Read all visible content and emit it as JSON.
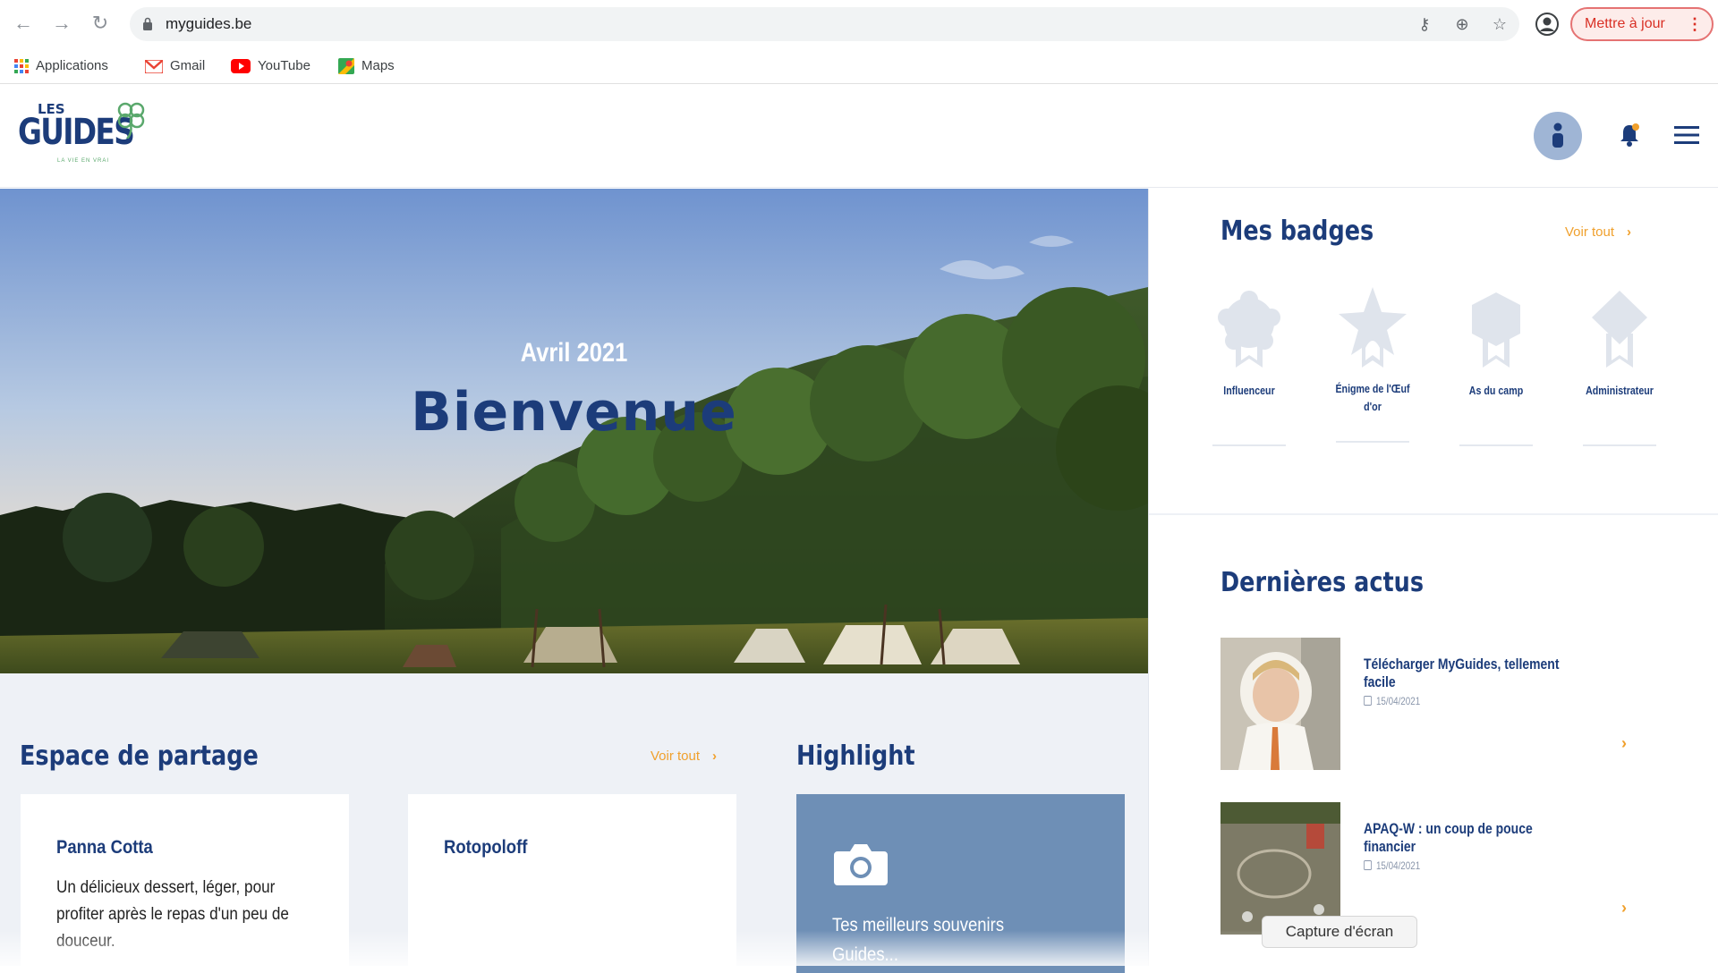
{
  "browser": {
    "url": "myguides.be",
    "update_label": "Mettre à jour",
    "update_dots": "⋮",
    "bookmarks": [
      {
        "label": "Applications",
        "icon": "apps-grid-icon"
      },
      {
        "label": "Gmail",
        "icon": "gmail-icon"
      },
      {
        "label": "YouTube",
        "icon": "youtube-icon"
      },
      {
        "label": "Maps",
        "icon": "maps-icon"
      }
    ]
  },
  "logo": {
    "les": "LES",
    "guides": "GUIDES",
    "tagline": "LA VIE EN VRAI"
  },
  "hero": {
    "date": "Avril 2021",
    "title": "Bienvenue"
  },
  "sharing": {
    "title": "Espace de partage",
    "voir_tout": "Voir tout",
    "cards": [
      {
        "title": "Panna Cotta",
        "text": "Un délicieux dessert, léger, pour profiter après le repas d'un peu de douceur."
      },
      {
        "title": "Rotopoloff",
        "text": ""
      }
    ]
  },
  "highlight": {
    "title": "Highlight",
    "text": "Tes meilleurs souvenirs Guides..."
  },
  "badges": {
    "title": "Mes badges",
    "voir_tout": "Voir tout",
    "items": [
      {
        "label": "Influenceur",
        "shape": "flower"
      },
      {
        "label": "Énigme de l'Œuf d'or",
        "shape": "star"
      },
      {
        "label": "As du camp",
        "shape": "hexagon"
      },
      {
        "label": "Administrateur",
        "shape": "diamond"
      }
    ]
  },
  "news": {
    "title": "Dernières actus",
    "items": [
      {
        "title": "Télécharger MyGuides, tellement facile",
        "date": "15/04/2021"
      },
      {
        "title": "APAQ-W : un coup de pouce financier",
        "date": "15/04/2021"
      }
    ]
  },
  "tooltip": "Capture d'écran",
  "colors": {
    "brand_blue": "#1c3c7a",
    "accent_orange": "#f0a02c",
    "highlight_blue": "#6e8fb6",
    "badge_grey": "#dfe4ec"
  }
}
